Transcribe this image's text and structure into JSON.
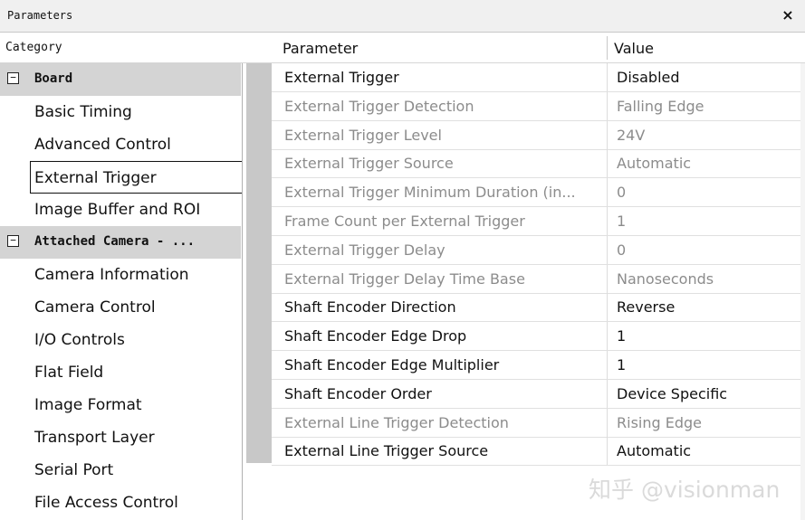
{
  "window": {
    "title": "Parameters",
    "close_glyph": "×"
  },
  "headers": {
    "category": "Category",
    "parameter": "Parameter",
    "value": "Value"
  },
  "categories": [
    {
      "label": "Board",
      "type": "group",
      "toggle": "−"
    },
    {
      "label": "Basic Timing",
      "type": "leaf"
    },
    {
      "label": "Advanced Control",
      "type": "leaf"
    },
    {
      "label": "External Trigger",
      "type": "leaf",
      "selected": true
    },
    {
      "label": "Image Buffer and ROI",
      "type": "leaf"
    },
    {
      "label": "Attached Camera - ...",
      "type": "group",
      "toggle": "−"
    },
    {
      "label": "Camera Information",
      "type": "leaf"
    },
    {
      "label": "Camera Control",
      "type": "leaf"
    },
    {
      "label": "I/O Controls",
      "type": "leaf"
    },
    {
      "label": "Flat Field",
      "type": "leaf"
    },
    {
      "label": "Image Format",
      "type": "leaf"
    },
    {
      "label": "Transport Layer",
      "type": "leaf"
    },
    {
      "label": "Serial Port",
      "type": "leaf"
    },
    {
      "label": "File Access Control",
      "type": "leaf"
    }
  ],
  "rows": [
    {
      "param": "External Trigger",
      "value": "Disabled",
      "enabled": true
    },
    {
      "param": "External Trigger Detection",
      "value": "Falling Edge",
      "enabled": false
    },
    {
      "param": "External Trigger Level",
      "value": "24V",
      "enabled": false
    },
    {
      "param": "External Trigger Source",
      "value": "Automatic",
      "enabled": false
    },
    {
      "param": "External Trigger Minimum Duration (in...",
      "value": "0",
      "enabled": false
    },
    {
      "param": "Frame Count per External Trigger",
      "value": "1",
      "enabled": false
    },
    {
      "param": "External Trigger Delay",
      "value": "0",
      "enabled": false
    },
    {
      "param": "External Trigger Delay Time Base",
      "value": "Nanoseconds",
      "enabled": false
    },
    {
      "param": "Shaft Encoder Direction",
      "value": "Reverse",
      "enabled": true
    },
    {
      "param": "Shaft Encoder Edge Drop",
      "value": "1",
      "enabled": true
    },
    {
      "param": "Shaft Encoder Edge Multiplier",
      "value": "1",
      "enabled": true
    },
    {
      "param": "Shaft Encoder Order",
      "value": "Device Specific",
      "enabled": true
    },
    {
      "param": "External Line Trigger Detection",
      "value": "Rising Edge",
      "enabled": false
    },
    {
      "param": "External Line Trigger Source",
      "value": "Automatic",
      "enabled": true
    }
  ],
  "watermark": "知乎 @visionman",
  "colors": {
    "group_bg": "#d4d4d4",
    "disabled_text": "#8c8c8c",
    "gutter": "#c8c8c8"
  }
}
